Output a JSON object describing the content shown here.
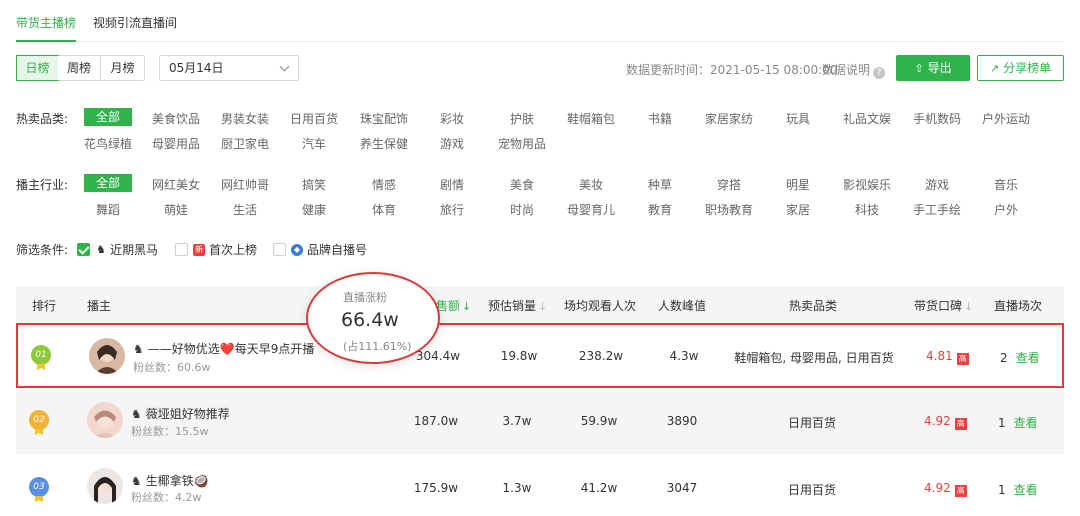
{
  "tabs": [
    {
      "label": "带货主播榜",
      "active": true
    },
    {
      "label": "视频引流直播间",
      "active": false
    }
  ],
  "period_tabs": [
    {
      "label": "日榜",
      "active": true
    },
    {
      "label": "周榜",
      "active": false
    },
    {
      "label": "月榜",
      "active": false
    }
  ],
  "date_select": {
    "value": "05月14日"
  },
  "update_time": "数据更新时间：2021-05-15 08:00:00",
  "data_note": "数据说明",
  "export_label": "导出",
  "share_label": "分享榜单",
  "filters": {
    "category_label": "热卖品类:",
    "categories_row1": [
      "全部",
      "美食饮品",
      "男装女装",
      "日用百货",
      "珠宝配饰",
      "彩妆",
      "护肤",
      "鞋帽箱包",
      "书籍",
      "家居家纺",
      "玩具",
      "礼品文娱",
      "手机数码",
      "户外运动"
    ],
    "categories_row2": [
      "花鸟绿植",
      "母婴用品",
      "厨卫家电",
      "汽车",
      "养生保健",
      "游戏",
      "宠物用品"
    ],
    "industry_label": "播主行业:",
    "industries_row1": [
      "全部",
      "网红美女",
      "网红帅哥",
      "搞笑",
      "情感",
      "剧情",
      "美食",
      "美妆",
      "种草",
      "穿搭",
      "明星",
      "影视娱乐",
      "游戏",
      "音乐"
    ],
    "industries_row2": [
      "舞蹈",
      "萌娃",
      "生活",
      "健康",
      "体育",
      "旅行",
      "时尚",
      "母婴育儿",
      "教育",
      "职场教育",
      "家居",
      "科技",
      "手工手绘",
      "户外"
    ],
    "conditions_label": "筛选条件:",
    "conditions": [
      {
        "label": "近期黑马",
        "checked": true
      },
      {
        "label": "首次上榜",
        "checked": false,
        "badge": "新"
      },
      {
        "label": "品牌自播号",
        "checked": false
      }
    ]
  },
  "table": {
    "headers": {
      "rank": "排行",
      "streamer": "播主",
      "sales_amount": "售额",
      "est_sales": "预估销量",
      "avg_viewers": "场均观看人次",
      "peak_viewers": "人数峰值",
      "hot_categories": "热卖品类",
      "reputation": "带货口碑",
      "sessions": "直播场次"
    },
    "rows": [
      {
        "rank": "01",
        "name": "——好物优选❤️每天早9点开播",
        "fans": "粉丝数：60.6w",
        "sales_amount": "304.4w",
        "est_sales": "19.8w",
        "avg_viewers": "238.2w",
        "peak_viewers": "4.3w",
        "hot_categories": "鞋帽箱包, 母婴用品, 日用百货",
        "reputation": "4.81",
        "reputation_badge": "高",
        "sessions": "2",
        "view": "查看"
      },
      {
        "rank": "02",
        "name": "薇垭姐好物推荐",
        "fans": "粉丝数：15.5w",
        "sales_amount": "187.0w",
        "est_sales": "3.7w",
        "avg_viewers": "59.9w",
        "peak_viewers": "3890",
        "hot_categories": "日用百货",
        "reputation": "4.92",
        "reputation_badge": "高",
        "sessions": "1",
        "view": "查看"
      },
      {
        "rank": "03",
        "name": "生椰拿铁🥥",
        "fans": "粉丝数：4.2w",
        "sales_amount": "175.9w",
        "est_sales": "1.3w",
        "avg_viewers": "41.2w",
        "peak_viewers": "3047",
        "hot_categories": "日用百货",
        "reputation": "4.92",
        "reputation_badge": "高",
        "sessions": "1",
        "view": "查看"
      }
    ]
  },
  "tooltip": {
    "title": "直播涨粉",
    "value": "66.4w",
    "share": "(占111.61%)"
  },
  "colors": {
    "accent": "#2fb34a",
    "highlight": "#e53935",
    "rating": "#e94040"
  }
}
